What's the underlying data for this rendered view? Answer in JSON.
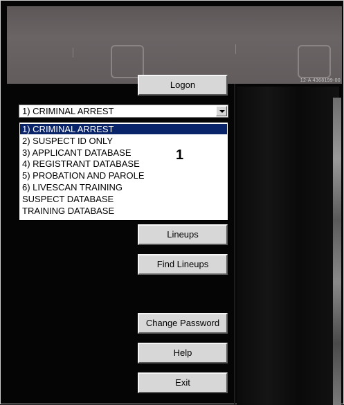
{
  "banner": {
    "code_text": "12-A   4368199-00"
  },
  "buttons": {
    "logon": "Logon",
    "lineups": "Lineups",
    "find_lineups": "Find Lineups",
    "change_password": "Change Password",
    "help": "Help",
    "exit": "Exit"
  },
  "database_select": {
    "selected_value": "1) CRIMINAL ARREST",
    "options": [
      "1) CRIMINAL ARREST",
      "2) SUSPECT ID ONLY",
      "3) APPLICANT DATABASE",
      "4) REGISTRANT DATABASE",
      "5) PROBATION AND PAROLE",
      "6) LIVESCAN TRAINING",
      "SUSPECT DATABASE",
      "TRAINING DATABASE"
    ],
    "highlighted_index": 0
  },
  "annotation": {
    "callout_label": "1"
  },
  "icons": {
    "dropdown_arrow": "chevron-down-icon"
  }
}
